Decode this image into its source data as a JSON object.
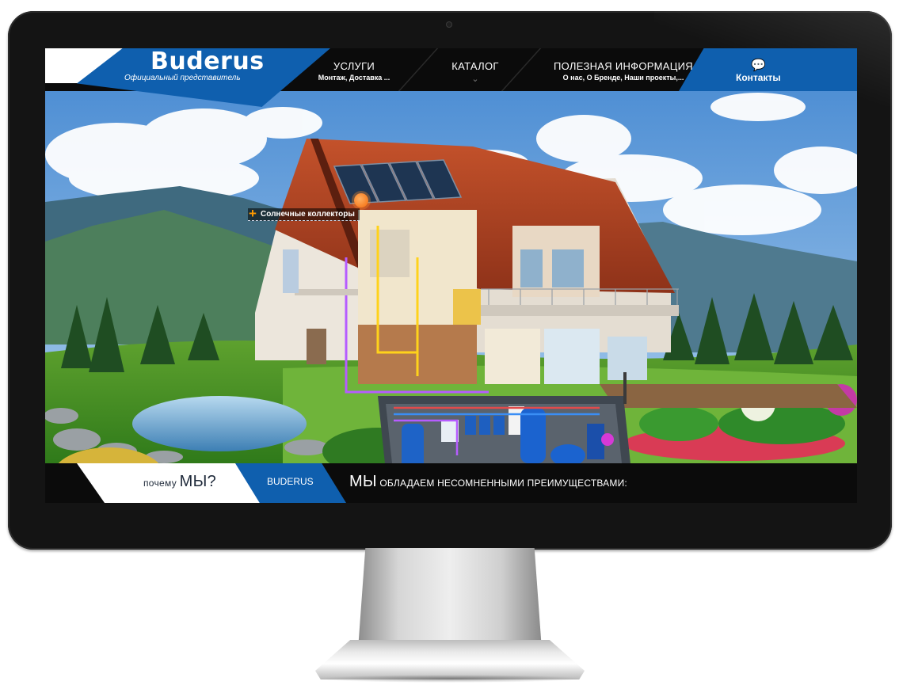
{
  "brand": {
    "name": "Buderus",
    "subtitle": "Официальный представитель"
  },
  "nav": [
    {
      "title": "УСЛУГИ",
      "sub": "Монтаж, Доставка ..."
    },
    {
      "title": "КАТАЛОГ",
      "sub": "⌄"
    },
    {
      "title": "ПОЛЕЗНАЯ ИНФОРМАЦИЯ",
      "sub": "О нас, О Бренде, Наши проекты,..."
    }
  ],
  "contacts": {
    "label": "Контакты",
    "icon": "chat-bubbles-icon"
  },
  "hotspot": {
    "label": "Солнечные коллекторы",
    "icon": "plus-icon"
  },
  "bottom": {
    "why_prefix": "почему",
    "why_big": "МЫ?",
    "brand_tab": "BUDERUS",
    "adv_big": "МЫ",
    "adv_rest": "ОБЛАДАЕМ НЕСОМНЕННЫМИ ПРЕИМУЩЕСТВАМИ:"
  },
  "colors": {
    "accent_blue": "#0f5fae",
    "bar_black": "#0b0b0b",
    "hotspot_orange": "#f46a0a"
  }
}
